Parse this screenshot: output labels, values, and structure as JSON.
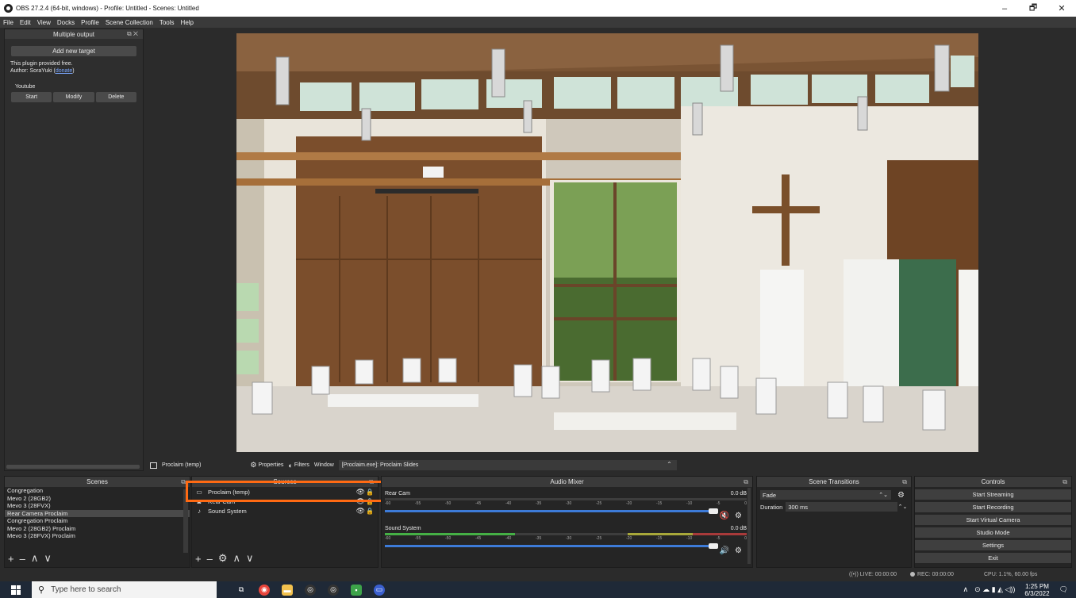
{
  "window": {
    "title": "OBS 27.2.4 (64-bit, windows) - Profile: Untitled - Scenes: Untitled",
    "minimize": "–",
    "maximize": "🗗",
    "close": "✕"
  },
  "menu": [
    "File",
    "Edit",
    "View",
    "Docks",
    "Profile",
    "Scene Collection",
    "Tools",
    "Help"
  ],
  "multiple_output": {
    "title": "Multiple output",
    "dock_ctrl": "⧉ ✕",
    "add_target": "Add new target",
    "info_line1": "This plugin provided free.",
    "info_author_prefix": "Author: SoraYuki (",
    "info_donate": "donate",
    "info_author_suffix": ")",
    "target_name": "Youtube",
    "buttons": [
      "Start",
      "Modify",
      "Delete"
    ]
  },
  "source_toolbar": {
    "source_name": "Proclaim (temp)",
    "properties": "Properties",
    "filters": "Filters",
    "window_label": "Window",
    "window_value": "[Proclaim.exe]: Proclaim Slides",
    "arrow": "⌃"
  },
  "scenes": {
    "title": "Scenes",
    "items": [
      "Congregation",
      "Mevo 2 (28GB2)",
      "Mevo 3 (28FVX)",
      "Rear Camera Proclaim",
      "Congregation Proclaim",
      "Mevo 2 (28GB2) Proclaim",
      "Mevo 3 (28FVX) Proclaim"
    ],
    "active_index": 3
  },
  "sources": {
    "title": "Sources",
    "items": [
      {
        "name": "Proclaim (temp)",
        "icon": "window-icon"
      },
      {
        "name": "Rear Cam",
        "icon": "camera-icon"
      },
      {
        "name": "Sound System",
        "icon": "mic-icon"
      }
    ]
  },
  "audio_mixer": {
    "title": "Audio Mixer",
    "ticks": [
      "-60",
      "-55",
      "-50",
      "-45",
      "-40",
      "-35",
      "-30",
      "-25",
      "-20",
      "-15",
      "-10",
      "-5",
      "0"
    ],
    "channels": [
      {
        "name": "Rear Cam",
        "db": "0.0 dB",
        "muted": true,
        "level": 0.0
      },
      {
        "name": "Sound System",
        "db": "0.0 dB",
        "muted": false,
        "level": 0.36
      }
    ]
  },
  "scene_transitions": {
    "title": "Scene Transitions",
    "transition": "Fade",
    "duration_label": "Duration",
    "duration_value": "300 ms"
  },
  "controls": {
    "title": "Controls",
    "buttons": [
      "Start Streaming",
      "Start Recording",
      "Start Virtual Camera",
      "Studio Mode",
      "Settings",
      "Exit"
    ]
  },
  "status": {
    "live": "LIVE: 00:00:00",
    "rec": "REC: 00:00:00",
    "cpu": "CPU: 1.1%, 60.00 fps"
  },
  "taskbar": {
    "search_placeholder": "Type here to search",
    "time": "1:25 PM",
    "date": "6/3/2022"
  },
  "colors": {
    "highlight": "#ff6a13",
    "mute_red": "#e02020",
    "volume_blue": "#3d7bd8"
  }
}
